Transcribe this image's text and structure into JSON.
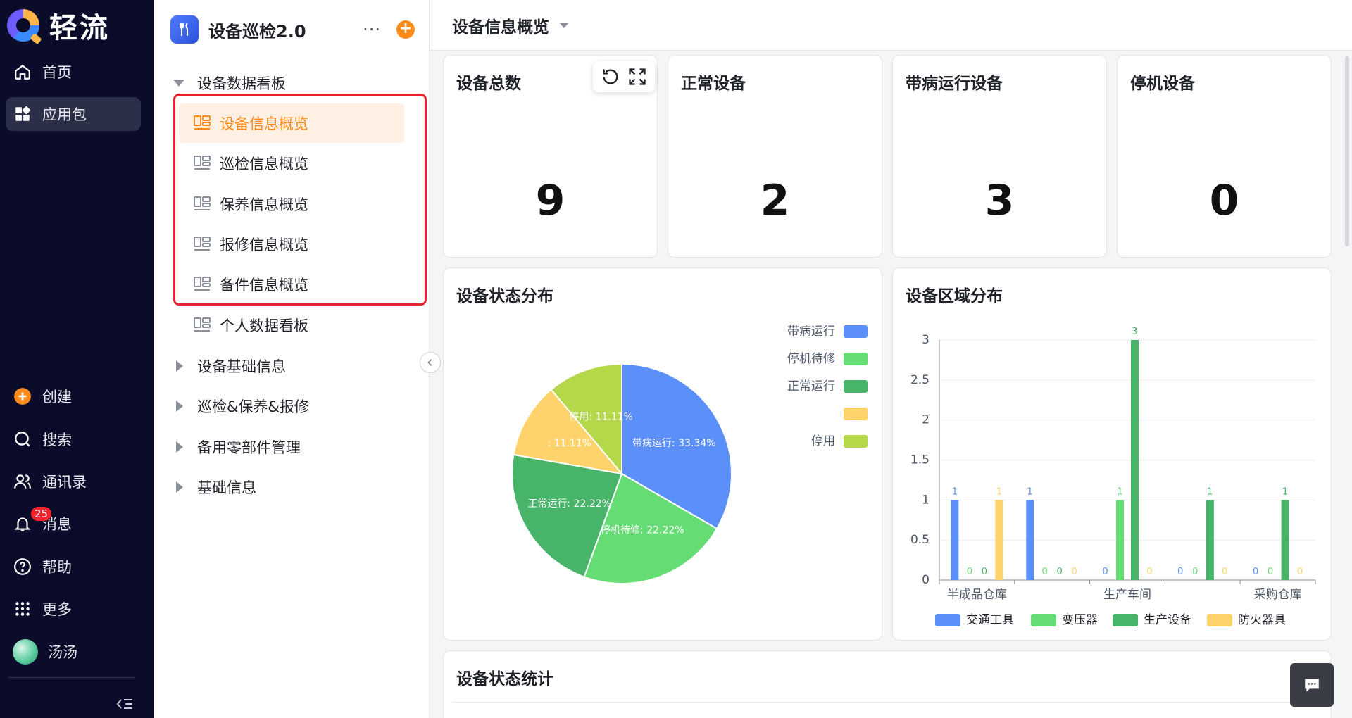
{
  "nav": {
    "logo_text": "轻流",
    "items": [
      {
        "label": "首页",
        "icon": "home-icon"
      },
      {
        "label": "应用包",
        "icon": "apps-icon"
      }
    ],
    "bottom_items": [
      {
        "label": "创建",
        "icon": "plus-icon"
      },
      {
        "label": "搜索",
        "icon": "search-icon"
      },
      {
        "label": "通讯录",
        "icon": "contacts-icon"
      },
      {
        "label": "消息",
        "icon": "bell-icon",
        "badge": "25"
      },
      {
        "label": "帮助",
        "icon": "help-icon"
      },
      {
        "label": "更多",
        "icon": "grid-icon"
      },
      {
        "label": "汤汤",
        "icon": "avatar"
      }
    ]
  },
  "app": {
    "title": "设备巡检2.0",
    "more": "···",
    "add": "+"
  },
  "tree": {
    "group_expanded": "设备数据看板",
    "leaves": [
      "设备信息概览",
      "巡检信息概览",
      "保养信息概览",
      "报修信息概览",
      "备件信息概览",
      "个人数据看板"
    ],
    "groups_collapsed": [
      "设备基础信息",
      "巡检&保养&报修",
      "备用零部件管理",
      "基础信息"
    ]
  },
  "page": {
    "title": "设备信息概览"
  },
  "stats": [
    {
      "label": "设备总数",
      "value": "9"
    },
    {
      "label": "正常设备",
      "value": "2"
    },
    {
      "label": "带病运行设备",
      "value": "3"
    },
    {
      "label": "停机设备",
      "value": "0"
    }
  ],
  "chart_data": [
    {
      "type": "pie",
      "title": "设备状态分布",
      "slices": [
        {
          "name": "带病运行",
          "value": 33.34,
          "label": "带病运行: 33.34%",
          "color": "#5b8ff9"
        },
        {
          "name": "停机待修",
          "value": 22.22,
          "label": "停机待修: 22.22%",
          "color": "#66dc75"
        },
        {
          "name": "正常运行",
          "value": 22.22,
          "label": "正常运行: 22.22%",
          "color": "#47b46a"
        },
        {
          "name": "",
          "value": 11.11,
          "label": ": 11.11%",
          "color": "#ffd36b"
        },
        {
          "name": "停用",
          "value": 11.11,
          "label": "停用: 11.11%",
          "color": "#b4d84a"
        }
      ],
      "legend_placement": "right"
    },
    {
      "type": "bar",
      "title": "设备区域分布",
      "category_labels": [
        "半成品仓库",
        "生产车间",
        "采购仓库"
      ],
      "groups": 5,
      "ylim": [
        0,
        3
      ],
      "yticks": [
        "0",
        "0.5",
        "1",
        "1.5",
        "2",
        "2.5",
        "3"
      ],
      "series": [
        {
          "name": "交通工具",
          "color": "#5b8ff9",
          "values": [
            1,
            1,
            0,
            0,
            0
          ]
        },
        {
          "name": "变压器",
          "color": "#66dc75",
          "values": [
            0,
            0,
            1,
            0,
            0
          ]
        },
        {
          "name": "生产设备",
          "color": "#47b46a",
          "values": [
            0,
            0,
            3,
            1,
            1
          ]
        },
        {
          "name": "防火器具",
          "color": "#ffd36b",
          "values": [
            1,
            0,
            0,
            0,
            0
          ]
        }
      ],
      "legend_placement": "bottom",
      "grid": true
    }
  ],
  "table_card": {
    "title": "设备状态统计"
  }
}
